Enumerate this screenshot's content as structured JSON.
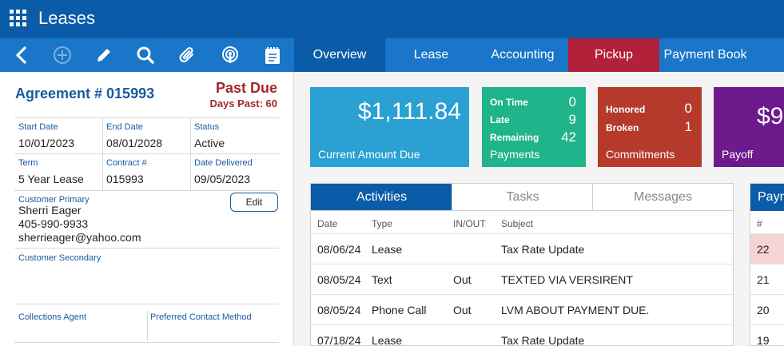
{
  "app": {
    "title": "Leases"
  },
  "toolbar": {
    "icons": [
      "back-icon",
      "add-icon",
      "edit-pencil-icon",
      "search-icon",
      "attachment-icon",
      "podcast-icon",
      "notepad-icon"
    ]
  },
  "tabs": [
    {
      "label": "Overview",
      "state": "active"
    },
    {
      "label": "Lease"
    },
    {
      "label": "Accounting"
    },
    {
      "label": "Pickup",
      "color": "#b3203a"
    },
    {
      "label": "Payment Book"
    }
  ],
  "agreement": {
    "title": "Agreement # 015993",
    "status_banner": "Past Due",
    "days_past": "Days Past: 60",
    "fields": {
      "start_date": {
        "label": "Start Date",
        "value": "10/01/2023"
      },
      "end_date": {
        "label": "End Date",
        "value": "08/01/2028"
      },
      "status": {
        "label": "Status",
        "value": "Active"
      },
      "term": {
        "label": "Term",
        "value": "5 Year Lease"
      },
      "contract": {
        "label": "Contract #",
        "value": "015993"
      },
      "date_delivered": {
        "label": "Date Delivered",
        "value": "09/05/2023"
      }
    },
    "customer_primary": {
      "label": "Customer Primary",
      "name": "Sherri Eager",
      "phone": "405-990-9933",
      "email": "sherrieager@yahoo.com",
      "edit_label": "Edit"
    },
    "customer_secondary": {
      "label": "Customer Secondary"
    },
    "collections_agent": {
      "label": "Collections Agent"
    },
    "preferred_contact": {
      "label": "Preferred Contact Method"
    }
  },
  "cards": {
    "current_due": {
      "amount": "$1,111.84",
      "title": "Current Amount Due",
      "color": "#2aa0d3"
    },
    "payments": {
      "title": "Payments",
      "color": "#1fb48a",
      "stats": [
        {
          "label": "On Time",
          "value": "0"
        },
        {
          "label": "Late",
          "value": "9"
        },
        {
          "label": "Remaining",
          "value": "42"
        }
      ]
    },
    "commitments": {
      "title": "Commitments",
      "color": "#b53a2c",
      "stats": [
        {
          "label": "Honored",
          "value": "0"
        },
        {
          "label": "Broken",
          "value": "1"
        }
      ]
    },
    "payoff": {
      "amount": "$9",
      "title": "Payoff",
      "color": "#6c1a8c"
    }
  },
  "activity_panel": {
    "tabs": [
      "Activities",
      "Tasks",
      "Messages"
    ],
    "columns": [
      "Date",
      "Type",
      "IN/OUT",
      "Subject"
    ],
    "rows": [
      {
        "date": "08/06/24",
        "type": "Lease",
        "inout": "",
        "subject": "Tax Rate Update"
      },
      {
        "date": "08/05/24",
        "type": "Text",
        "inout": "Out",
        "subject": "TEXTED VIA VERSIRENT"
      },
      {
        "date": "08/05/24",
        "type": "Phone Call",
        "inout": "Out",
        "subject": "LVM ABOUT PAYMENT DUE."
      },
      {
        "date": "07/18/24",
        "type": "Lease",
        "inout": "",
        "subject": "Tax Rate Update"
      }
    ]
  },
  "payments_panel": {
    "title": "Paym",
    "column": "#",
    "rows": [
      "22",
      "21",
      "20",
      "19"
    ]
  }
}
